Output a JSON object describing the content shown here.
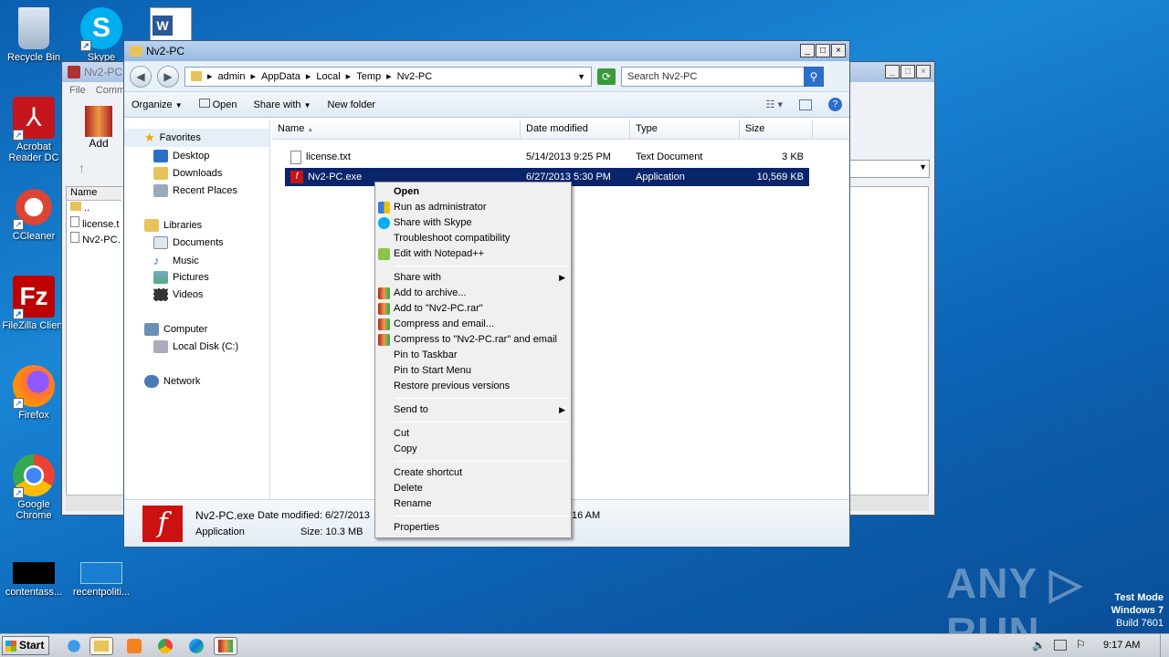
{
  "desktop": {
    "icons": [
      {
        "label": "Recycle Bin"
      },
      {
        "label": "Skype"
      },
      {
        "label": "Acrobat Reader DC"
      },
      {
        "label": "CCleaner"
      },
      {
        "label": "FileZilla Client"
      },
      {
        "label": "Firefox"
      },
      {
        "label": "Google Chrome"
      },
      {
        "label": "contentass..."
      },
      {
        "label": "recentpoliti..."
      }
    ],
    "watermark": {
      "brand": "ANY ▷ RUN",
      "line1": "Test Mode",
      "line2": "Windows 7",
      "line3": "Build 7601"
    }
  },
  "back_window": {
    "title": "Nv2-PC",
    "menu": [
      "File",
      "Comm"
    ],
    "add_label": "Add",
    "col_name": "Name",
    "rows": [
      "..",
      "license.t",
      "Nv2-PC."
    ]
  },
  "explorer": {
    "title": "Nv2-PC",
    "breadcrumb": [
      "admin",
      "AppData",
      "Local",
      "Temp",
      "Nv2-PC"
    ],
    "search_placeholder": "Search Nv2-PC",
    "toolbar": {
      "organize": "Organize",
      "open": "Open",
      "share_with": "Share with",
      "new_folder": "New folder"
    },
    "nav": {
      "favorites": "Favorites",
      "desktop": "Desktop",
      "downloads": "Downloads",
      "recent": "Recent Places",
      "libraries": "Libraries",
      "documents": "Documents",
      "music": "Music",
      "pictures": "Pictures",
      "videos": "Videos",
      "computer": "Computer",
      "local_disk": "Local Disk (C:)",
      "network": "Network"
    },
    "columns": {
      "name": "Name",
      "date": "Date modified",
      "type": "Type",
      "size": "Size"
    },
    "files": [
      {
        "name": "license.txt",
        "date": "5/14/2013 9:25 PM",
        "type": "Text Document",
        "size": "3 KB"
      },
      {
        "name": "Nv2-PC.exe",
        "date": "6/27/2013 5:30 PM",
        "type": "Application",
        "size": "10,569 KB"
      }
    ],
    "details": {
      "name": "Nv2-PC.exe",
      "date_label": "Date modified: 6/27/2013",
      "time_tail": "16 AM",
      "type": "Application",
      "size_label": "Size: 10.3 MB"
    }
  },
  "context_menu": {
    "groups": [
      [
        "Open",
        "Run as administrator",
        "Share with Skype",
        "Troubleshoot compatibility",
        "Edit with Notepad++"
      ],
      [
        "Share with",
        "Add to archive...",
        "Add to \"Nv2-PC.rar\"",
        "Compress and email...",
        "Compress to \"Nv2-PC.rar\" and email",
        "Pin to Taskbar",
        "Pin to Start Menu",
        "Restore previous versions"
      ],
      [
        "Send to"
      ],
      [
        "Cut",
        "Copy"
      ],
      [
        "Create shortcut",
        "Delete",
        "Rename"
      ],
      [
        "Properties"
      ]
    ]
  },
  "taskbar": {
    "start": "Start",
    "clock": "9:17 AM"
  },
  "colors": {
    "selection": "#0a246a",
    "accent": "#2a6fc8"
  }
}
